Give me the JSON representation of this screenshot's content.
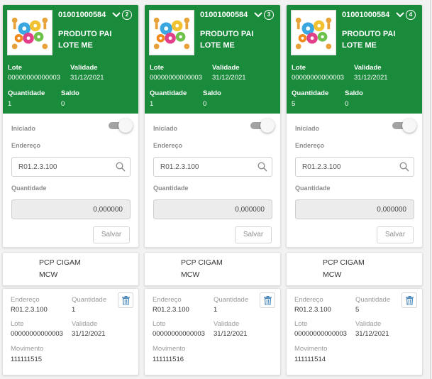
{
  "colors": {
    "header_green": "#1a8b3b",
    "icon_blue": "#4a87b8"
  },
  "cards": [
    {
      "code": "01001000584",
      "badge": "2",
      "product_line1": "PRODUTO PAI",
      "product_line2": "LOTE ME",
      "lote_label": "Lote",
      "lote": "00000000000003",
      "validade_label": "Validade",
      "validade": "31/12/2021",
      "quantidade_label": "Quantidade",
      "quantidade": "1",
      "saldo_label": "Saldo",
      "saldo": "0",
      "iniciado_label": "Iniciado",
      "endereco_label": "Endereço",
      "endereco_value": "R01.2.3.100",
      "qty_label": "Quantidade",
      "qty_value": "0,000000",
      "save_label": "Salvar",
      "org_line1": "PCP CIGAM",
      "org_line2": "MCW",
      "mov": {
        "endereco_label": "Endereço",
        "endereco": "R01.2.3.100",
        "quantidade_label": "Quantidade",
        "quantidade": "1",
        "lote_label": "Lote",
        "lote": "00000000000003",
        "validade_label": "Validade",
        "validade": "31/12/2021",
        "movimento_label": "Movimento",
        "movimento": "111111515"
      }
    },
    {
      "code": "01001000584",
      "badge": "3",
      "product_line1": "PRODUTO PAI",
      "product_line2": "LOTE ME",
      "lote_label": "Lote",
      "lote": "00000000000003",
      "validade_label": "Validade",
      "validade": "31/12/2021",
      "quantidade_label": "Quantidade",
      "quantidade": "1",
      "saldo_label": "Saldo",
      "saldo": "0",
      "iniciado_label": "Iniciado",
      "endereco_label": "Endereço",
      "endereco_value": "R01.2.3.100",
      "qty_label": "Quantidade",
      "qty_value": "0,000000",
      "save_label": "Salvar",
      "org_line1": "PCP CIGAM",
      "org_line2": "MCW",
      "mov": {
        "endereco_label": "Endereço",
        "endereco": "R01.2.3.100",
        "quantidade_label": "Quantidade",
        "quantidade": "1",
        "lote_label": "Lote",
        "lote": "00000000000003",
        "validade_label": "Validade",
        "validade": "31/12/2021",
        "movimento_label": "Movimento",
        "movimento": "111111516"
      }
    },
    {
      "code": "01001000584",
      "badge": "4",
      "product_line1": "PRODUTO PAI",
      "product_line2": "LOTE ME",
      "lote_label": "Lote",
      "lote": "00000000000003",
      "validade_label": "Validade",
      "validade": "31/12/2021",
      "quantidade_label": "Quantidade",
      "quantidade": "5",
      "saldo_label": "Saldo",
      "saldo": "0",
      "iniciado_label": "Iniciado",
      "endereco_label": "Endereço",
      "endereco_value": "R01.2.3.100",
      "qty_label": "Quantidade",
      "qty_value": "0,000000",
      "save_label": "Salvar",
      "org_line1": "PCP CIGAM",
      "org_line2": "MCW",
      "mov": {
        "endereco_label": "Endereço",
        "endereco": "R01.2.3.100",
        "quantidade_label": "Quantidade",
        "quantidade": "5",
        "lote_label": "Lote",
        "lote": "00000000000003",
        "validade_label": "Validade",
        "validade": "31/12/2021",
        "movimento_label": "Movimento",
        "movimento": "111111514"
      }
    }
  ]
}
